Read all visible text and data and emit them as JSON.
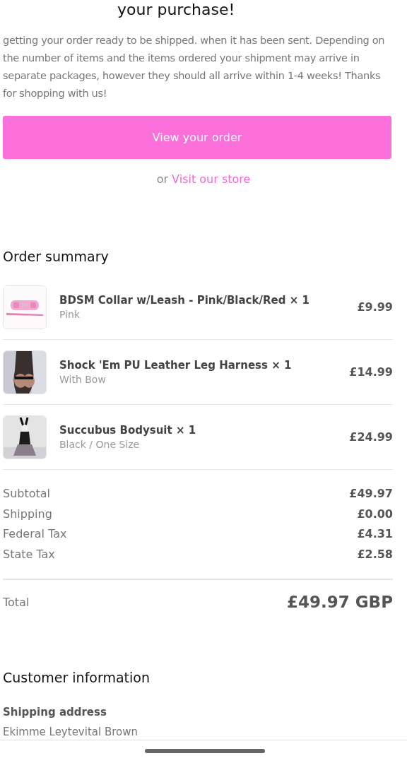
{
  "header": {
    "title": "your purchase!",
    "message": "getting your order ready to be shipped. when it has been sent. Depending on the number of items and the items ordered your shipment may arrive in separate packages, however they should all arrive within 1-4 weeks! Thanks for shopping with us!"
  },
  "actions": {
    "primary_button": "View your order",
    "or_text": "or",
    "store_link": "Visit our store"
  },
  "order_summary": {
    "title": "Order summary",
    "items": [
      {
        "name": "BDSM Collar w/Leash - Pink/Black/Red × 1",
        "variant": "Pink",
        "price": "£9.99"
      },
      {
        "name": "Shock 'Em PU Leather Leg Harness × 1",
        "variant": "With Bow",
        "price": "£14.99"
      },
      {
        "name": "Succubus Bodysuit × 1",
        "variant": "Black / One Size",
        "price": "£24.99"
      }
    ],
    "lines": [
      {
        "label": "Subtotal",
        "value": "£49.97"
      },
      {
        "label": "Shipping",
        "value": "£0.00"
      },
      {
        "label": "Federal Tax",
        "value": "£4.31"
      },
      {
        "label": "State Tax",
        "value": "£2.58"
      }
    ],
    "total": {
      "label": "Total",
      "value": "£49.97 GBP"
    }
  },
  "customer_information": {
    "title": "Customer information",
    "shipping_address": {
      "title": "Shipping address",
      "name": "Ekimme Leytevital Brown"
    }
  }
}
